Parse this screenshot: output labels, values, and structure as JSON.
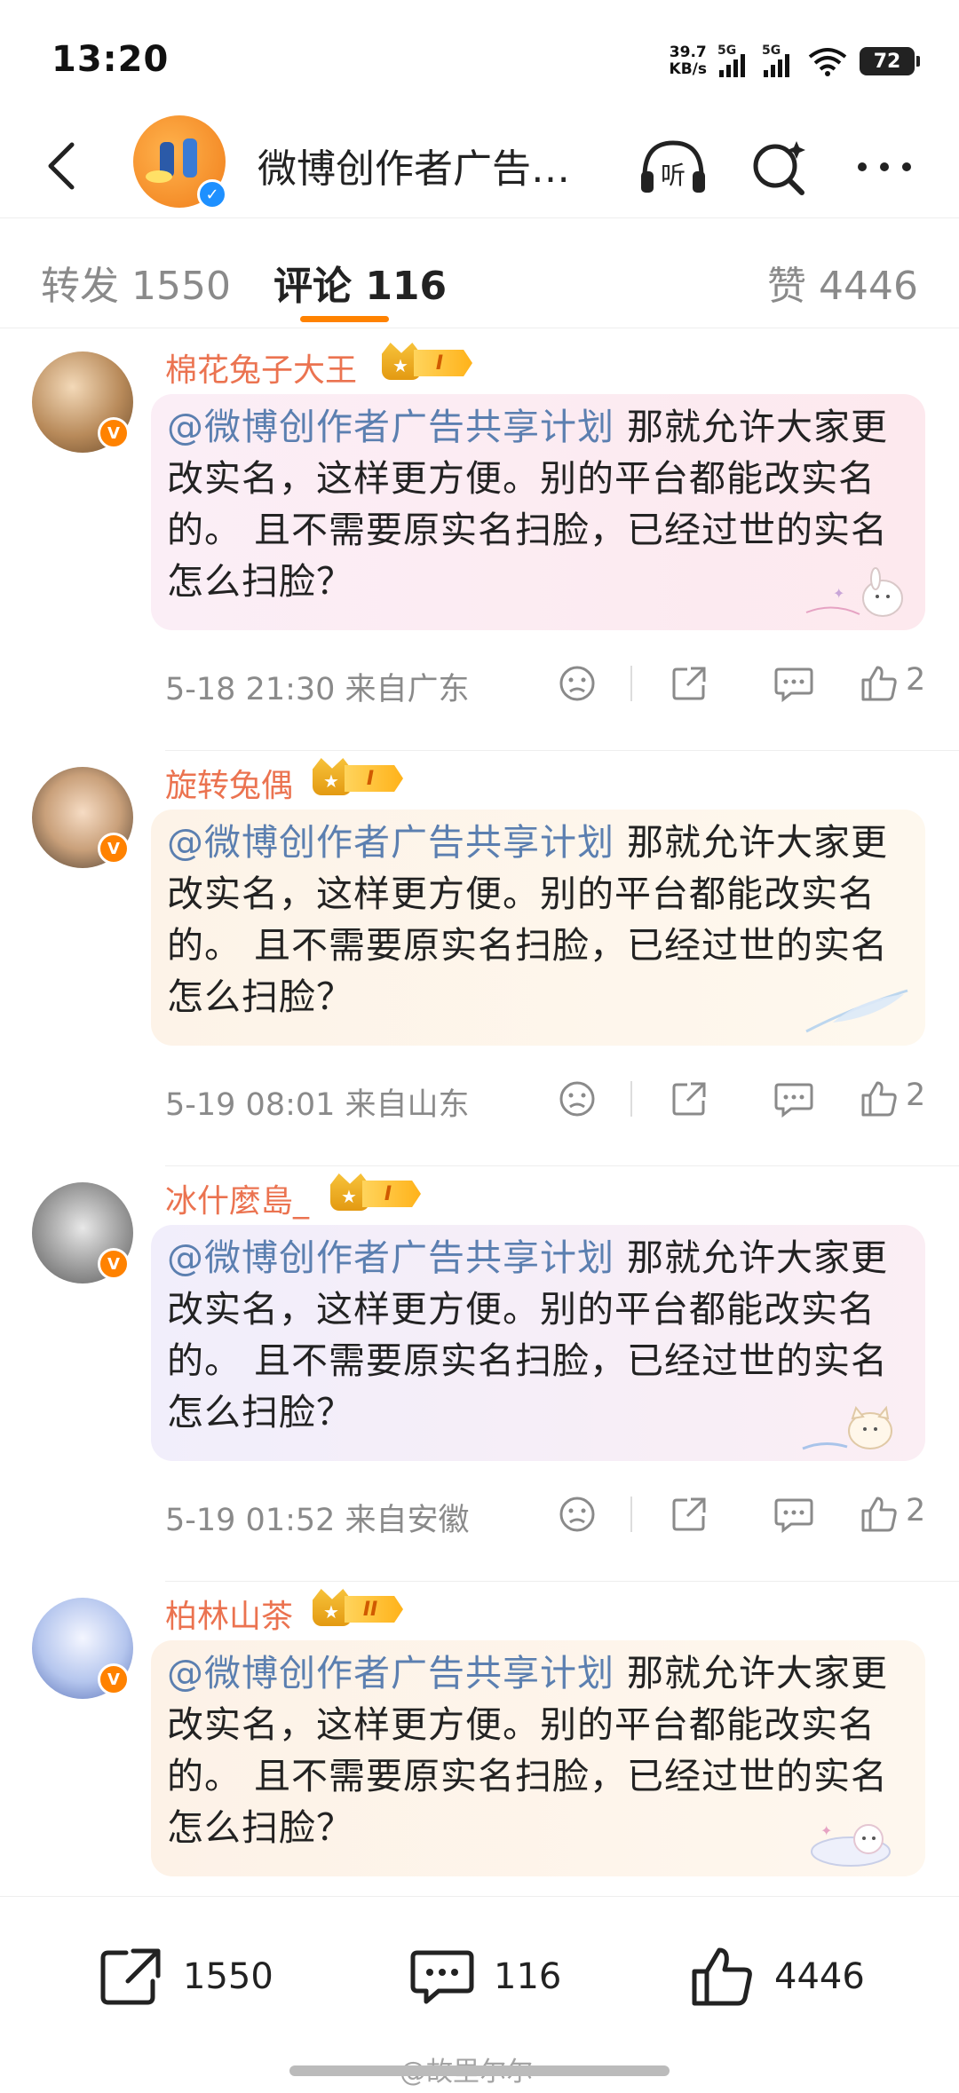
{
  "status_bar": {
    "time": "13:20",
    "net_speed_value": "39.7",
    "net_speed_unit": "KB/s",
    "signal1_label": "5G",
    "signal2_label": "5G",
    "battery": "72"
  },
  "header": {
    "title": "微博创作者广告…",
    "listen_label": "听",
    "icons": [
      "back-arrow-icon",
      "headphones-icon",
      "search-sparkle-icon",
      "more-icon"
    ]
  },
  "tabs": {
    "repost": "转发 1550",
    "comments": "评论 116",
    "likes": "赞 4446",
    "accent_color": "#ff8200"
  },
  "comments": [
    {
      "username": "棉花兔子大王",
      "level": "I",
      "mention": "@微博创作者广告共享计划",
      "text": " 那就允许大家更改实名，这样更方便。别的平台都能改实名的。 且不需要原实名扫脸，已经过世的实名怎么扫脸？",
      "meta": "5-18 21:30  来自广东",
      "likes": "2",
      "bubble_color": "#fdeef3"
    },
    {
      "username": "旋转兔偶",
      "level": "I",
      "mention": "@微博创作者广告共享计划",
      "text": " 那就允许大家更改实名，这样更方便。别的平台都能改实名的。 且不需要原实名扫脸，已经过世的实名怎么扫脸？",
      "meta": "5-19 08:01  来自山东",
      "likes": "2",
      "bubble_color": "#fdf5e9"
    },
    {
      "username": "冰什麼島_",
      "level": "I",
      "mention": "@微博创作者广告共享计划",
      "text": " 那就允许大家更改实名，这样更方便。别的平台都能改实名的。 且不需要原实名扫脸，已经过世的实名怎么扫脸？",
      "meta": "5-19 01:52  来自安徽",
      "likes": "2",
      "bubble_color": "#f6eefa"
    },
    {
      "username": "柏林山茶",
      "level": "II",
      "mention": "@微博创作者广告共享计划",
      "text": " 那就允许大家更改实名，这样更方便。别的平台都能改实名的。 且不需要原实名扫脸，已经过世的实名怎么扫脸？",
      "meta": "",
      "likes": "",
      "bubble_color": "#fdf4ea"
    }
  ],
  "bottom_bar": {
    "repost_count": "1550",
    "comment_count": "116",
    "like_count": "4446"
  },
  "watermark": "@故里尔尔"
}
